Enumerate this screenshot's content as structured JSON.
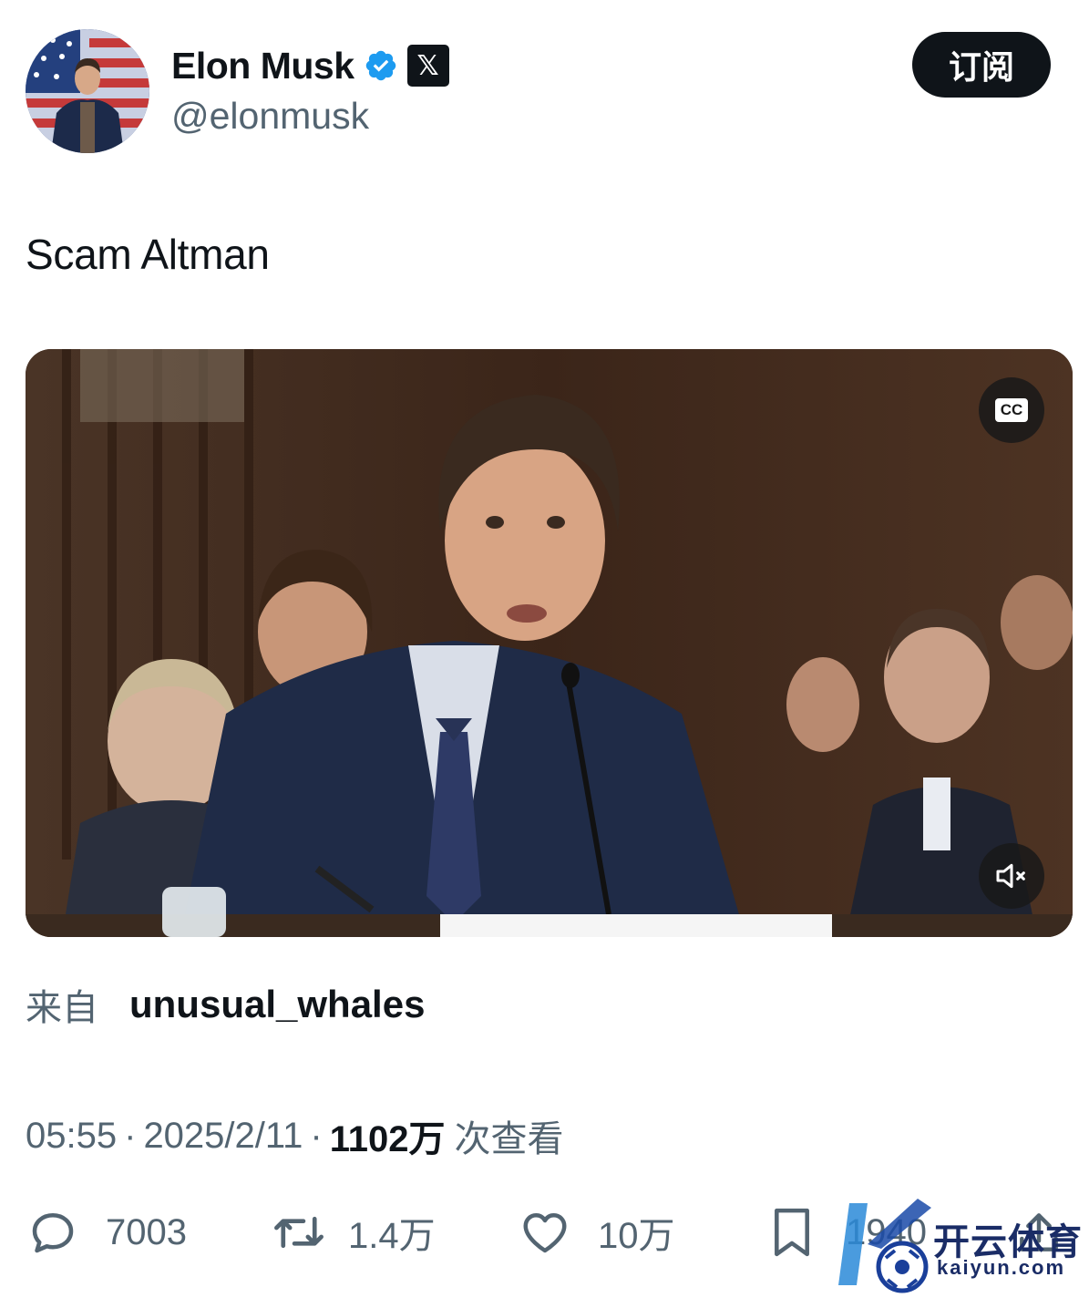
{
  "author": {
    "display_name": "Elon Musk",
    "handle": "@elonmusk",
    "verified": true,
    "affiliation_badge": "𝕏"
  },
  "subscribe_label": "订阅",
  "tweet_text": "Scam Altman",
  "media": {
    "type": "video",
    "cc_label": "CC",
    "controls": [
      "closed-captions-icon",
      "mute-icon"
    ]
  },
  "source": {
    "prefix": "来自",
    "username": "unusual_whales"
  },
  "meta": {
    "time": "05:55",
    "separator": "·",
    "date": "2025/2/11",
    "views_count": "1102万",
    "views_label": "次查看"
  },
  "actions": {
    "replies": "7003",
    "reposts": "1.4万",
    "likes": "10万",
    "bookmarks": "1940"
  },
  "watermark": {
    "cn": "开云体育",
    "en": "kaiyun.com"
  },
  "colors": {
    "text_primary": "#0f1419",
    "text_secondary": "#536471",
    "verified_blue": "#1d9bf0",
    "button_bg": "#0f1419"
  }
}
